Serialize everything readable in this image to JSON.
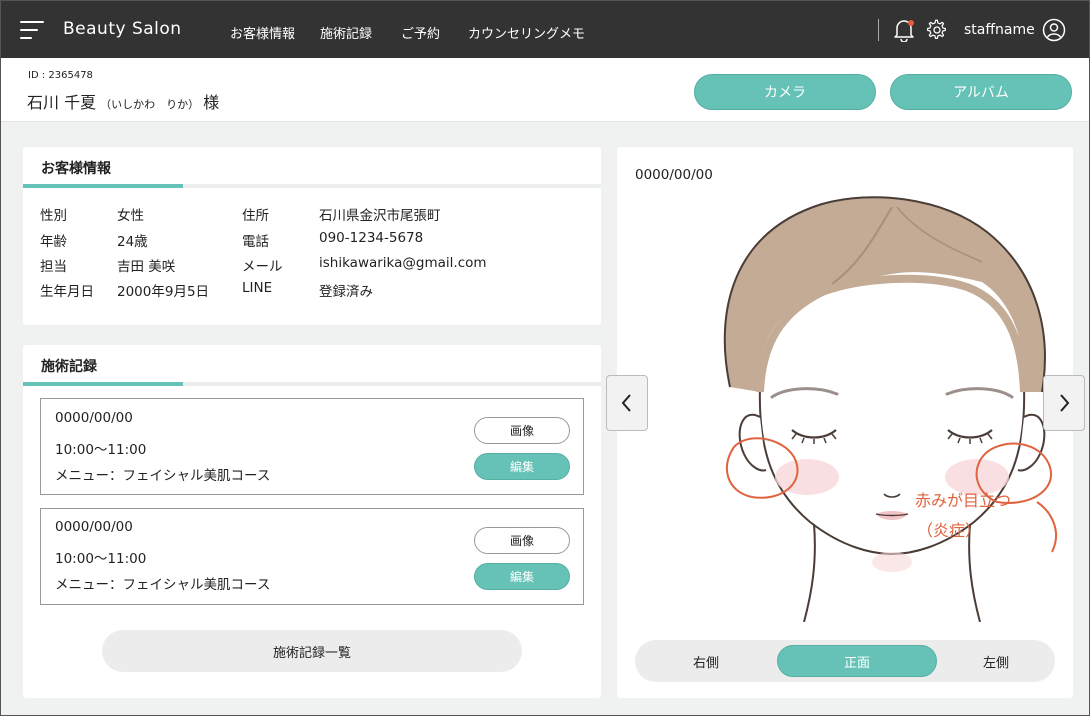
{
  "app": {
    "brand": "Beauty Salon",
    "username": "staffname"
  },
  "nav": [
    "お客様情報",
    "施術記録",
    "ご予約",
    "カウンセリングメモ"
  ],
  "customer": {
    "id_label": "ID : 2365478",
    "name": "石川 千夏",
    "kana": "（いしかわ　りか）",
    "honorific": "様"
  },
  "header_buttons": {
    "camera": "カメラ",
    "album": "アルバム"
  },
  "info_card": {
    "title": "お客様情報",
    "left": [
      {
        "label": "性別",
        "value": "女性"
      },
      {
        "label": "年齢",
        "value": "24歳"
      },
      {
        "label": "担当",
        "value": "吉田 美咲"
      },
      {
        "label": "生年月日",
        "value": "2000年9月5日"
      }
    ],
    "right": [
      {
        "label": "住所",
        "value": "石川県金沢市尾張町"
      },
      {
        "label": "電話",
        "value": "090-1234-5678"
      },
      {
        "label": "メール",
        "value": "ishikawarika@gmail.com"
      },
      {
        "label": "LINE",
        "value": "登録済み"
      }
    ]
  },
  "records_card": {
    "title": "施術記録",
    "records": [
      {
        "date": "0000/00/00",
        "time": "10:00〜11:00",
        "menu": "メニュー：フェイシャル美肌コース",
        "image_btn": "画像",
        "edit_btn": "編集"
      },
      {
        "date": "0000/00/00",
        "time": "10:00〜11:00",
        "menu": "メニュー：フェイシャル美肌コース",
        "image_btn": "画像",
        "edit_btn": "編集"
      }
    ],
    "list_button": "施術記録一覧"
  },
  "image_panel": {
    "date": "0000/00/00",
    "note_line1": "赤みが目立つ",
    "note_line2": "（炎症）",
    "views": [
      "右側",
      "正面",
      "左側"
    ],
    "active_view": "正面"
  },
  "colors": {
    "accent": "#66c2b6",
    "topbar": "#333333",
    "annotation": "#e0633f",
    "hair": "#c3ab96"
  }
}
